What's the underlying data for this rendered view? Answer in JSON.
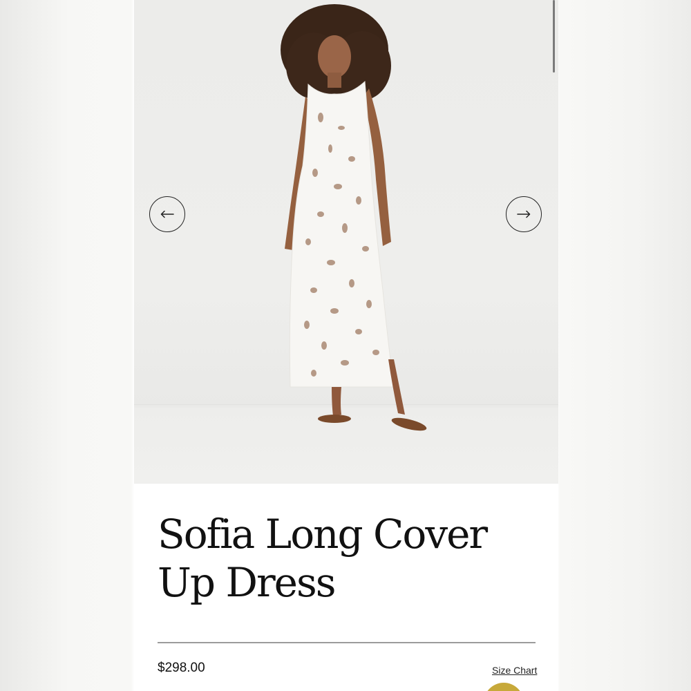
{
  "gallery": {
    "prev_icon": "arrow-left-icon",
    "next_icon": "arrow-right-icon",
    "image_description_icon": "product-photo"
  },
  "product": {
    "title": "Sofia Long Cover Up Dress",
    "price": "$298.00",
    "size_chart_label": "Size Chart"
  },
  "colors": {
    "accent_gold": "#c7a93a",
    "text": "#111111",
    "divider": "#9c9c9c"
  }
}
